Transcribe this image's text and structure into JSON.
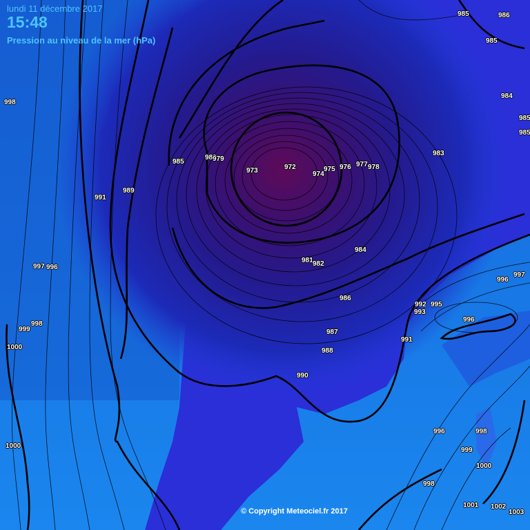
{
  "header": {
    "date": "lundi 11 décembre 2017",
    "time": "15:48",
    "title": "Pression au niveau de la mer (hPa)"
  },
  "copyright": "© Copyright Meteociel.fr 2017",
  "colors": {
    "ocean": "#1e78e6",
    "land": "#2a2fd8",
    "low_center": "#5a0a5e",
    "isobar": "#000000",
    "header_text": "#4ec3ff"
  },
  "isobar_labels": [
    "985",
    "986",
    "985",
    "984",
    "985",
    "985",
    "998",
    "980",
    "979",
    "973",
    "972",
    "974",
    "975",
    "976",
    "977",
    "978",
    "983",
    "985",
    "991",
    "989",
    "997",
    "996",
    "981",
    "982",
    "984",
    "999",
    "998",
    "1000",
    "986",
    "992",
    "993",
    "995",
    "996",
    "997",
    "996",
    "987",
    "988",
    "991",
    "990",
    "996",
    "998",
    "999",
    "1000",
    "1000",
    "998",
    "1001",
    "1002",
    "1003"
  ]
}
